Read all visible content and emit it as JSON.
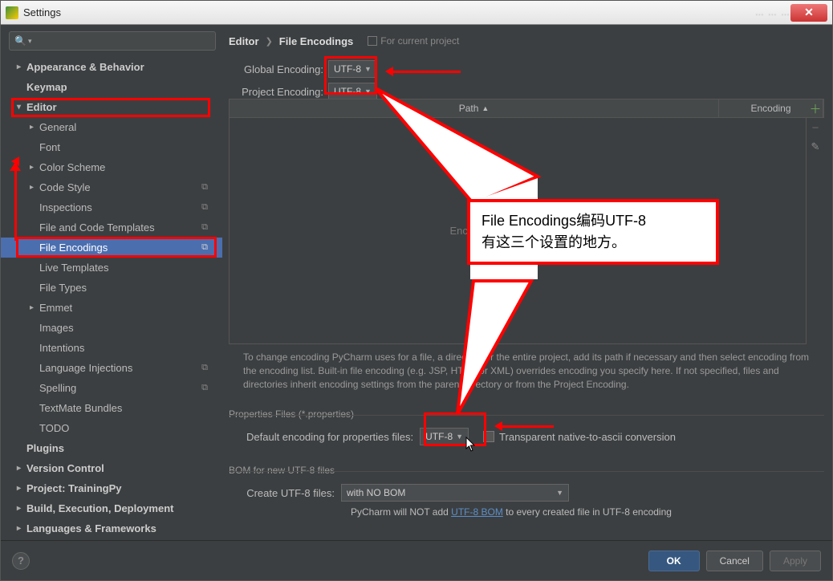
{
  "window": {
    "title": "Settings"
  },
  "titlebar_blur": "…   …   …",
  "sidebar": {
    "items": [
      {
        "label": "Appearance & Behavior",
        "arrow": "right",
        "bold": true,
        "lvl": 0
      },
      {
        "label": "Keymap",
        "arrow": "none",
        "bold": true,
        "lvl": 0
      },
      {
        "label": "Editor",
        "arrow": "down",
        "bold": true,
        "lvl": 0
      },
      {
        "label": "General",
        "arrow": "right",
        "bold": false,
        "lvl": 1
      },
      {
        "label": "Font",
        "arrow": "none",
        "bold": false,
        "lvl": 1
      },
      {
        "label": "Color Scheme",
        "arrow": "right",
        "bold": false,
        "lvl": 1
      },
      {
        "label": "Code Style",
        "arrow": "right",
        "bold": false,
        "lvl": 1,
        "copy": true
      },
      {
        "label": "Inspections",
        "arrow": "none",
        "bold": false,
        "lvl": 1,
        "copy": true
      },
      {
        "label": "File and Code Templates",
        "arrow": "none",
        "bold": false,
        "lvl": 1,
        "copy": true
      },
      {
        "label": "File Encodings",
        "arrow": "none",
        "bold": false,
        "lvl": 1,
        "copy": true,
        "selected": true
      },
      {
        "label": "Live Templates",
        "arrow": "none",
        "bold": false,
        "lvl": 1
      },
      {
        "label": "File Types",
        "arrow": "none",
        "bold": false,
        "lvl": 1
      },
      {
        "label": "Emmet",
        "arrow": "right",
        "bold": false,
        "lvl": 1
      },
      {
        "label": "Images",
        "arrow": "none",
        "bold": false,
        "lvl": 1
      },
      {
        "label": "Intentions",
        "arrow": "none",
        "bold": false,
        "lvl": 1
      },
      {
        "label": "Language Injections",
        "arrow": "none",
        "bold": false,
        "lvl": 1,
        "copy": true
      },
      {
        "label": "Spelling",
        "arrow": "none",
        "bold": false,
        "lvl": 1,
        "copy": true
      },
      {
        "label": "TextMate Bundles",
        "arrow": "none",
        "bold": false,
        "lvl": 1
      },
      {
        "label": "TODO",
        "arrow": "none",
        "bold": false,
        "lvl": 1
      },
      {
        "label": "Plugins",
        "arrow": "none",
        "bold": true,
        "lvl": 0
      },
      {
        "label": "Version Control",
        "arrow": "right",
        "bold": true,
        "lvl": 0
      },
      {
        "label": "Project: TrainingPy",
        "arrow": "right",
        "bold": true,
        "lvl": 0
      },
      {
        "label": "Build, Execution, Deployment",
        "arrow": "right",
        "bold": true,
        "lvl": 0
      },
      {
        "label": "Languages & Frameworks",
        "arrow": "right",
        "bold": true,
        "lvl": 0
      }
    ]
  },
  "breadcrumb": {
    "root": "Editor",
    "leaf": "File Encodings",
    "project_tag": "For current project"
  },
  "global_encoding": {
    "label": "Global Encoding:",
    "value": "UTF-8"
  },
  "project_encoding": {
    "label": "Project Encoding:",
    "value": "UTF-8"
  },
  "table": {
    "col_path": "Path",
    "col_enc": "Encoding",
    "placeholder": "Encodings are not configured"
  },
  "help_text": "To change encoding PyCharm uses for a file, a directory or the entire project, add its path if necessary and then select encoding from the encoding list. Built-in file encoding (e.g. JSP, HTML or XML) overrides encoding you specify here. If not specified, files and directories inherit encoding settings from the parent directory or from the Project Encoding.",
  "props": {
    "section": "Properties Files (*.properties)",
    "label": "Default encoding for properties files:",
    "value": "UTF-8",
    "checkbox_label": "Transparent native-to-ascii conversion"
  },
  "bom": {
    "section": "BOM for new UTF-8 files",
    "label": "Create UTF-8 files:",
    "value": "with NO BOM",
    "note_pre": "PyCharm will NOT add ",
    "note_link": "UTF-8 BOM",
    "note_post": " to every created file in UTF-8 encoding"
  },
  "footer": {
    "ok": "OK",
    "cancel": "Cancel",
    "apply": "Apply"
  },
  "annotation": {
    "callout_line1": "File  Encodings编码UTF-8",
    "callout_line2": "有这三个设置的地方。"
  }
}
